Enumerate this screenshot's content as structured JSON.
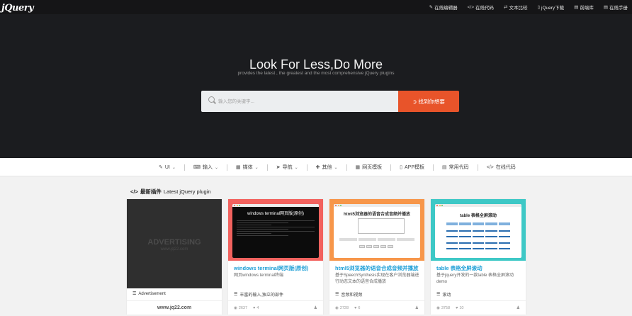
{
  "logo": {
    "text": "jQuery"
  },
  "topnav": [
    {
      "icon": "edit-icon",
      "glyph": "✎",
      "label": "在线编辑器"
    },
    {
      "icon": "code-icon",
      "glyph": "</>",
      "label": "在线代码"
    },
    {
      "icon": "compare-icon",
      "glyph": "⇄",
      "label": "文本比较"
    },
    {
      "icon": "download-icon",
      "glyph": "▯",
      "label": "jQuery下载"
    },
    {
      "icon": "library-icon",
      "glyph": "▤",
      "label": "前端库"
    },
    {
      "icon": "doc-icon",
      "glyph": "▤",
      "label": "在线手册"
    }
  ],
  "hero": {
    "title": "Look For Less,Do More",
    "subtitle": "provides the latest , the greatest and the most comprehensive jQuery plugins"
  },
  "search": {
    "placeholder": "输入您的关键字...",
    "button_label": "找到你想要"
  },
  "categories": [
    {
      "icon": "brush-icon",
      "glyph": "✎",
      "label": "UI",
      "dropdown": true
    },
    {
      "icon": "keyboard-icon",
      "glyph": "⌨",
      "label": "输入",
      "dropdown": true
    },
    {
      "icon": "film-icon",
      "glyph": "▦",
      "label": "媒体",
      "dropdown": true
    },
    {
      "icon": "plane-icon",
      "glyph": "➤",
      "label": "导航",
      "dropdown": true
    },
    {
      "icon": "puzzle-icon",
      "glyph": "✚",
      "label": "其他",
      "dropdown": true
    },
    {
      "icon": "grid-icon",
      "glyph": "▦",
      "label": "网页模板",
      "dropdown": false
    },
    {
      "icon": "mobile-icon",
      "glyph": "▯",
      "label": "APP模板",
      "dropdown": false
    },
    {
      "icon": "file-icon",
      "glyph": "▤",
      "label": "常用代码",
      "dropdown": false
    },
    {
      "icon": "code-icon",
      "glyph": "</>",
      "label": "在线代码",
      "dropdown": false
    }
  ],
  "section": {
    "icon_glyph": "</>",
    "title": "最新插件",
    "title_en": "Latest jQuery plugin"
  },
  "ad_card": {
    "big_text": "ADVERTISING",
    "small_text": "www.jq22.com",
    "label": "Advertisement",
    "footer": "www.jq22.com"
  },
  "cards": [
    {
      "thumb_color": "#f2625e",
      "thumb_title": "windows terminal网页版(原创)",
      "title": "windows terminal网页版(原创)",
      "desc": "网页windows terminal终端",
      "tag": "丰富的输入,独立的部件",
      "views": "2637",
      "likes": "4"
    },
    {
      "thumb_color": "#f7964a",
      "thumb_title": "html5浏览器的语音合成音频并播放",
      "title": "html5浏览器的语音合成音频并播放",
      "desc": "基于SpeechSynthesis实现在客户浏览器端进行动态文本的语音合成播放",
      "tag": "音频和视频",
      "views": "2728",
      "likes": "6"
    },
    {
      "thumb_color": "#3ec8c6",
      "thumb_title": "table 表格全屏滚动",
      "title": "table 表格全屏滚动",
      "desc": "基于jquery开发的一款table 表格全屏滚动demo",
      "tag": "滚动",
      "views": "3758",
      "likes": "10"
    }
  ]
}
